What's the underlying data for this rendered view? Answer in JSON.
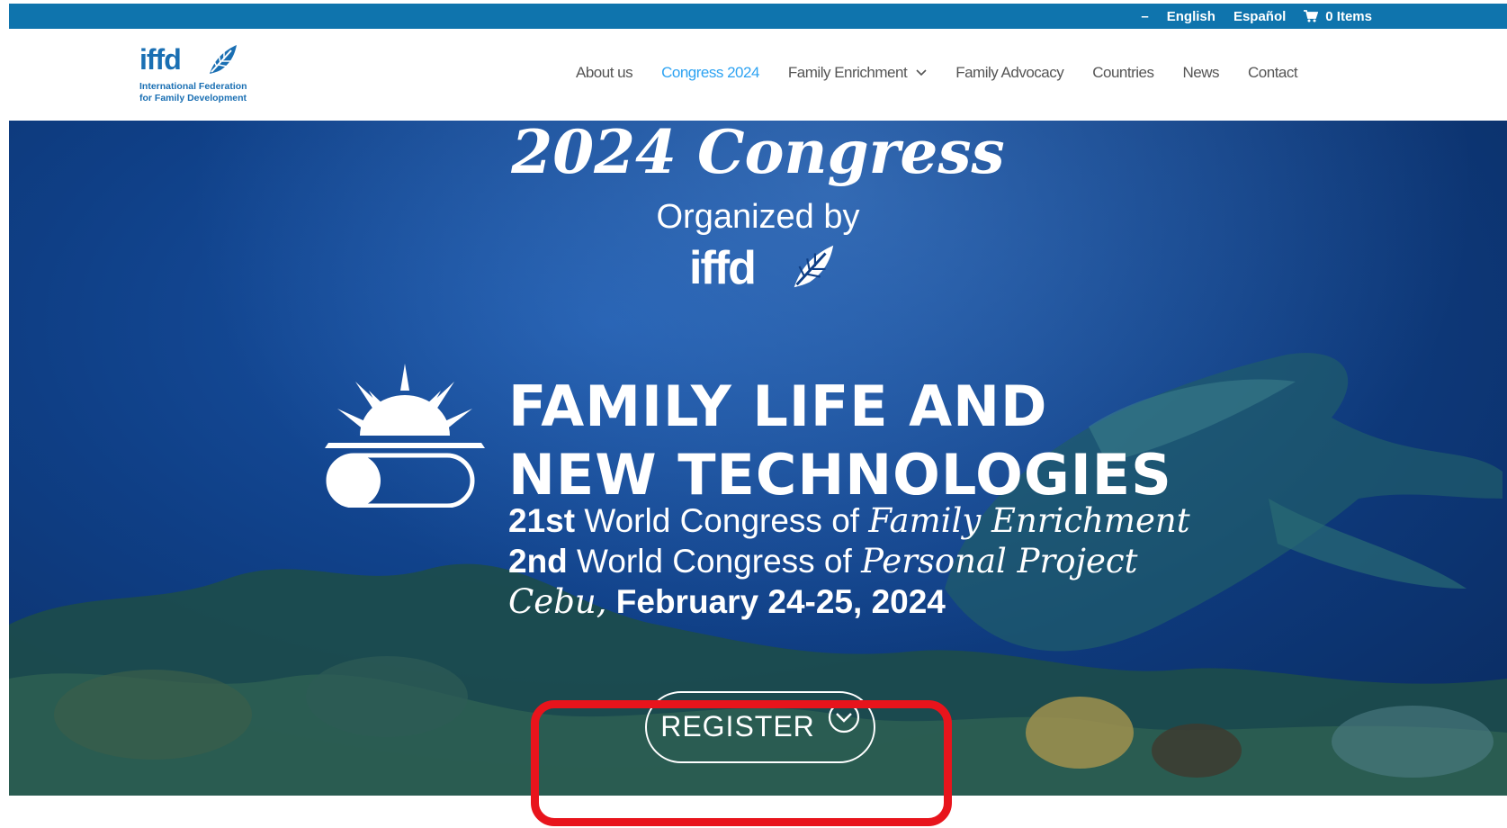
{
  "topbar": {
    "dash": "–",
    "lang_en": "English",
    "lang_es": "Español",
    "cart_label": "0 Items",
    "cart_icon": "shopping-cart-icon",
    "background": "#0f74ad"
  },
  "header": {
    "logo": {
      "wordmark": "iffd",
      "line1": "International Federation",
      "line2": "for Family Development"
    },
    "nav": [
      {
        "label": "About us"
      },
      {
        "label": "Congress 2024",
        "active": true
      },
      {
        "label": "Family Enrichment",
        "has_dropdown": true
      },
      {
        "label": "Family Advocacy"
      },
      {
        "label": "Countries"
      },
      {
        "label": "News"
      },
      {
        "label": "Contact"
      }
    ],
    "search_icon": "search-icon",
    "active_color": "#2ea3f2"
  },
  "hero": {
    "title": "2024 Congress",
    "organized_by": "Organized by",
    "org_logo": "iffd",
    "heading_line1": "FAMILY LIFE AND",
    "heading_line2": "NEW TECHNOLOGIES",
    "line1_bold": "21st",
    "line1_text": " World Congress of ",
    "line1_italic": "Family Enrichment",
    "line2_bold": "2nd",
    "line2_text": " World Congress of ",
    "line2_italic": "Personal Project",
    "line3_italic": "Cebu,",
    "line3_bold": " February 24-25, 2024",
    "register_label": "REGISTER",
    "register_icon": "chevron-down-circle-icon"
  },
  "annotation": {
    "highlight_color": "#e8141c"
  }
}
